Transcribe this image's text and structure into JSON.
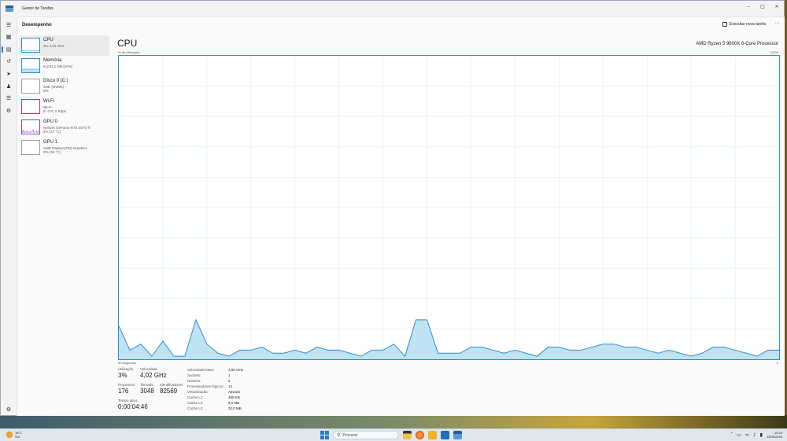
{
  "window": {
    "title": "Gestor de Tarefas"
  },
  "header": {
    "page_title": "Desempenho",
    "run_task_label": "Executar nova tarefa",
    "more": "···"
  },
  "rail_icons": [
    "menu-icon",
    "processes-icon",
    "performance-icon",
    "history-icon",
    "startup-icon",
    "users-icon",
    "details-icon",
    "services-icon",
    "settings-icon"
  ],
  "perf_items": [
    {
      "name": "CPU",
      "sub1": "3%  4,02 GHz",
      "sub2": "",
      "color": "#2a8fc9"
    },
    {
      "name": "Memória",
      "sub1": "6,1/31,1 GB (20%)",
      "sub2": "",
      "color": "#2a8fc9"
    },
    {
      "name": "Disco 0 (C:)",
      "sub1": "SSD (NVMe)",
      "sub2": "0%",
      "color": "#4caf50"
    },
    {
      "name": "Wi-Fi",
      "sub1": "Wi-Fi",
      "sub2": "E: 0 R: 0 Kbps",
      "color": "#c0395f"
    },
    {
      "name": "GPU 0",
      "sub1": "NVIDIA GeForce RTX 5070 Ti",
      "sub2": "2% (37 °C)",
      "color": "#8e44ad"
    },
    {
      "name": "GPU 1",
      "sub1": "AMD Radeon(TM) Graphics",
      "sub2": "0% (38 °C)",
      "color": "#8e44ad"
    }
  ],
  "main": {
    "title": "CPU",
    "model": "AMD Ryzen 5 9600X 6-Core Processor",
    "axis_top_label": "% de Utilização",
    "axis_top_right": "100%",
    "axis_bottom_left": "60 segundos",
    "axis_bottom_right": "0"
  },
  "chart_data": {
    "type": "area",
    "title": "CPU",
    "ylabel": "% de Utilização",
    "xlabel": "60 segundos",
    "ylim": [
      0,
      100
    ],
    "xlim": [
      60,
      0
    ],
    "color": "#2a8fc9",
    "fill": "#bfe3f3",
    "grid": true,
    "x": [
      60,
      59,
      58,
      57,
      56,
      55,
      54,
      53,
      52,
      51,
      50,
      49,
      48,
      47,
      46,
      45,
      44,
      43,
      42,
      41,
      40,
      39,
      38,
      37,
      36,
      35,
      34,
      33,
      32,
      31,
      30,
      29,
      28,
      27,
      26,
      25,
      24,
      23,
      22,
      21,
      20,
      19,
      18,
      17,
      16,
      15,
      14,
      13,
      12,
      11,
      10,
      9,
      8,
      7,
      6,
      5,
      4,
      3,
      2,
      1,
      0
    ],
    "values": [
      11,
      3,
      5,
      1,
      6,
      1,
      1,
      13,
      5,
      2,
      1,
      3,
      3,
      4,
      2,
      2,
      3,
      2,
      4,
      3,
      3,
      2,
      1,
      3,
      3,
      5,
      1,
      13,
      13,
      2,
      2,
      2,
      4,
      4,
      3,
      2,
      3,
      2,
      1,
      4,
      4,
      3,
      3,
      4,
      5,
      5,
      4,
      4,
      3,
      2,
      3,
      2,
      1,
      2,
      4,
      4,
      3,
      2,
      1,
      3,
      3
    ]
  },
  "stats": {
    "utilization": {
      "label": "Utilização",
      "value": "3%"
    },
    "speed": {
      "label": "Velocidade",
      "value": "4,02 GHz"
    },
    "processes": {
      "label": "Processos",
      "value": "176"
    },
    "threads": {
      "label": "Threads",
      "value": "3048"
    },
    "handles": {
      "label": "Identificadores",
      "value": "82569"
    },
    "uptime": {
      "label": "Tempo ativo",
      "value": "0:00:04:46"
    }
  },
  "specs": [
    {
      "k": "Velocidade base:",
      "v": "3,90 GHz"
    },
    {
      "k": "Sockets:",
      "v": "1"
    },
    {
      "k": "Núcleos:",
      "v": "6"
    },
    {
      "k": "Processadores lógicos:",
      "v": "12"
    },
    {
      "k": "Virtualização:",
      "v": "Ativado"
    },
    {
      "k": "Cache L1:",
      "v": "480 KB"
    },
    {
      "k": "Cache L2:",
      "v": "6,0 MB"
    },
    {
      "k": "Cache L3:",
      "v": "32,0 MB"
    }
  ],
  "taskbar": {
    "weather_temp": "18°C",
    "weather_desc": "Sol",
    "search_placeholder": "Procurar",
    "time": "19:24",
    "date": "13/05/2026"
  }
}
